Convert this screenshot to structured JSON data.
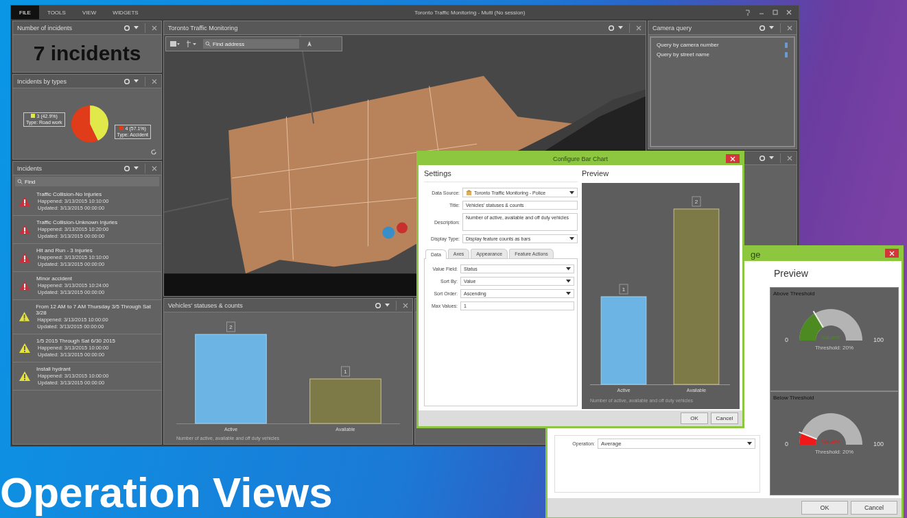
{
  "slide_title": "Operation Views",
  "window": {
    "title": "Toronto Traffic Monitoring - Multi (No session)",
    "menu": [
      {
        "label": "FILE",
        "selected": true
      },
      {
        "label": "TOOLS",
        "selected": false
      },
      {
        "label": "VIEW",
        "selected": false
      },
      {
        "label": "WIDGETS",
        "selected": false
      }
    ]
  },
  "incident_count": {
    "title": "Number of incidents",
    "value": "7 incidents"
  },
  "incidents_by_type": {
    "title": "Incidents by types",
    "chart_data": {
      "type": "pie",
      "categories": [
        "Type: Road work",
        "Type: Accident"
      ],
      "values": [
        3,
        4
      ],
      "value_labels": [
        "3 (42.9%)",
        "4 (57.1%)"
      ],
      "legend": "bottom left"
    }
  },
  "incidents": {
    "title": "Incidents",
    "search": {
      "placeholder": "Find"
    },
    "items": [
      {
        "kind": "accident",
        "title": "Traffic Collision-No Injuries",
        "happened": "Happened: 3/13/2015 10:10:00",
        "updated": "Updated: 3/13/2015 00:00:00"
      },
      {
        "kind": "accident",
        "title": "Traffic Collision-Unknown Injuries",
        "happened": "Happened: 3/13/2015 10:20:00",
        "updated": "Updated: 3/13/2015 00:00:00"
      },
      {
        "kind": "accident",
        "title": "Hit and Run - 3 Injuries",
        "happened": "Happened: 3/13/2015 10:10:00",
        "updated": "Updated: 3/13/2015 00:00:00"
      },
      {
        "kind": "accident",
        "title": "Minor accident",
        "happened": "Happened: 3/13/2015 10:24:00",
        "updated": "Updated: 3/13/2015 00:00:00"
      },
      {
        "kind": "roadwork",
        "title": "From 12 AM to 7 AM Thursday 3/5 Through Sat 3/28",
        "happened": "Happened: 3/13/2015 10:00:00",
        "updated": "Updated: 3/13/2015 00:00:00"
      },
      {
        "kind": "roadwork",
        "title": "1/5 2015 Through Sat 6/30 2015",
        "happened": "Happened: 3/13/2015 10:00:00",
        "updated": "Updated: 3/13/2015 00:00:00"
      },
      {
        "kind": "roadwork",
        "title": "Install hydrant",
        "happened": "Happened: 3/13/2015 10:00:00",
        "updated": "Updated: 3/13/2015 00:00:00"
      }
    ]
  },
  "map": {
    "title": "Toronto Traffic Monitoring",
    "search": {
      "placeholder": "Find address"
    }
  },
  "vehicles": {
    "title": "Vehicles' statuses & counts",
    "description": "Number of active, available and off duty vehicles",
    "chart_data": {
      "type": "bar",
      "categories": [
        "Active",
        "Available"
      ],
      "values": [
        2,
        1
      ],
      "data_labels": true
    }
  },
  "camera_query": {
    "title": "Camera query",
    "items": [
      {
        "label": "Query by camera number"
      },
      {
        "label": "Query by street name"
      }
    ]
  },
  "bar_dialog": {
    "title": "Configure Bar Chart",
    "settings_heading": "Settings",
    "preview_heading": "Preview",
    "fields": [
      {
        "kind": "select",
        "label": "Data Source:",
        "value": "Toronto Traffic Monitoring - Police"
      },
      {
        "kind": "text",
        "label": "Title:",
        "value": "Vehicles' statuses & counts"
      },
      {
        "kind": "textarea",
        "label": "Description:",
        "value": "Number of active, available and off duty vehicles"
      },
      {
        "kind": "select",
        "label": "Display Type:",
        "value": "Display feature counts as bars"
      }
    ],
    "tabs": [
      {
        "label": "Data",
        "selected": true
      },
      {
        "label": "Axes",
        "selected": false
      },
      {
        "label": "Appearance",
        "selected": false
      },
      {
        "label": "Feature Actions",
        "selected": false
      }
    ],
    "tab_fields": [
      {
        "kind": "select",
        "label": "Value Field:",
        "value": "Status"
      },
      {
        "kind": "select",
        "label": "Sort By:",
        "value": "Value"
      },
      {
        "kind": "select",
        "label": "Sort Order:",
        "value": "Ascending"
      },
      {
        "kind": "text",
        "label": "Max Values:",
        "value": "1"
      }
    ],
    "preview": {
      "description": "Number of active, available and off duty vehicles",
      "chart_data": {
        "type": "bar",
        "categories": [
          "Active",
          "Available"
        ],
        "values": [
          1,
          2
        ],
        "data_labels": true
      }
    },
    "buttons": [
      "OK",
      "Cancel"
    ]
  },
  "gauge_dialog": {
    "title": "ge",
    "preview_heading": "Preview",
    "gauges": [
      {
        "kind": "above",
        "title": "Above Threshold",
        "level": 0.33,
        "value_label": "Value%",
        "min": "0",
        "max": "100",
        "threshold": "Threshold: 20%"
      },
      {
        "kind": "below",
        "title": "Below Threshold",
        "level": 0.12,
        "value_label": "Value%",
        "min": "0",
        "max": "100",
        "threshold": "Threshold: 20%"
      }
    ],
    "fields": [
      {
        "label": "Operation:",
        "value": "Average"
      }
    ],
    "buttons": [
      "OK",
      "Cancel"
    ]
  }
}
